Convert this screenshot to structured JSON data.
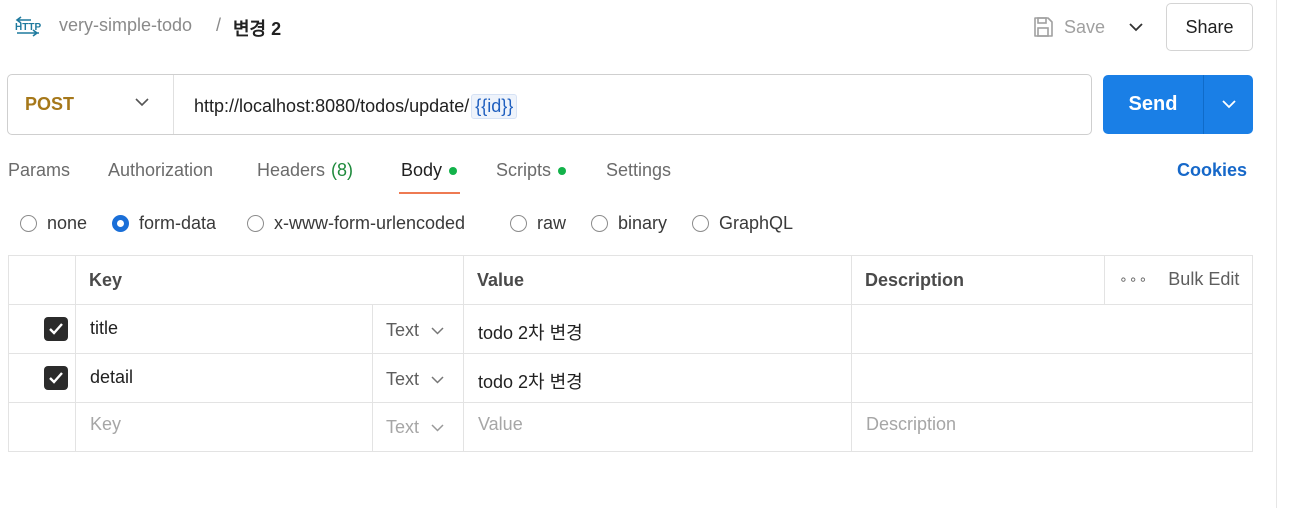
{
  "header": {
    "collection": "very-simple-todo",
    "separator": "/",
    "request_name": "변경 2",
    "save_label": "Save",
    "share_label": "Share"
  },
  "request": {
    "method": "POST",
    "url_base": "http://localhost:8080/todos/update/",
    "url_variable": "{{id}}",
    "send_label": "Send"
  },
  "tabs": {
    "params": "Params",
    "authorization": "Authorization",
    "headers": "Headers",
    "headers_count": "(8)",
    "body": "Body",
    "scripts": "Scripts",
    "settings": "Settings",
    "cookies": "Cookies",
    "active": "Body"
  },
  "body_types": {
    "none": "none",
    "form_data": "form-data",
    "urlencoded": "x-www-form-urlencoded",
    "raw": "raw",
    "binary": "binary",
    "graphql": "GraphQL",
    "selected": "form-data"
  },
  "table": {
    "headers": {
      "key": "Key",
      "value": "Value",
      "description": "Description",
      "bulk_edit": "Bulk Edit",
      "more": "∘∘∘"
    },
    "rows": [
      {
        "checked": true,
        "key": "title",
        "type": "Text",
        "value": "todo 2차 변경",
        "description": ""
      },
      {
        "checked": true,
        "key": "detail",
        "type": "Text",
        "value": "todo 2차 변경",
        "description": ""
      }
    ],
    "placeholder": {
      "key": "Key",
      "type": "Text",
      "value": "Value",
      "description": "Description"
    }
  },
  "colors": {
    "method": "#a6781a",
    "send": "#1a7fe6",
    "active_tab_underline": "#ee7a52",
    "status_dot": "#12b24a",
    "cookies": "#1668c9",
    "radio_selected": "#1a6fd8"
  },
  "icons": {
    "http": "http-icon",
    "save": "save-icon",
    "chevron": "chevron-down-icon",
    "checkbox": "checkmark-icon"
  }
}
